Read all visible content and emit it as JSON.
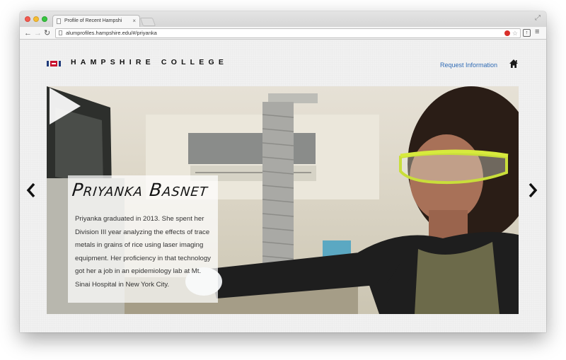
{
  "browser": {
    "tab_title": "Profile of Recent Hampshi",
    "tab_close": "×",
    "url": "alumprofiles.hampshire.edu/#/priyanka",
    "icons": {
      "back": "back-arrow-icon",
      "forward": "forward-arrow-icon",
      "reload": "reload-icon",
      "star": "star-icon",
      "menu": "hamburger-menu-icon"
    }
  },
  "site": {
    "logo_text": "HAMPSHIRE COLLEGE",
    "request_link": "Request Information",
    "home_icon": "home-icon",
    "brand_colors": {
      "red": "#c8102e",
      "navy": "#1f3a7a",
      "link": "#2f6bb5"
    }
  },
  "profile": {
    "name": "Priyanka Basnet",
    "bio": "Priyanka graduated in 2013. She spent her Division III year analyzing the effects of trace metals in grains of rice using laser imaging equipment. Her proficiency in that technology got her a job in an epidemiology lab at Mt. Sinai Hospital in New York City."
  },
  "carousel": {
    "prev_icon": "chevron-left-icon",
    "next_icon": "chevron-right-icon",
    "play_icon": "play-icon"
  }
}
